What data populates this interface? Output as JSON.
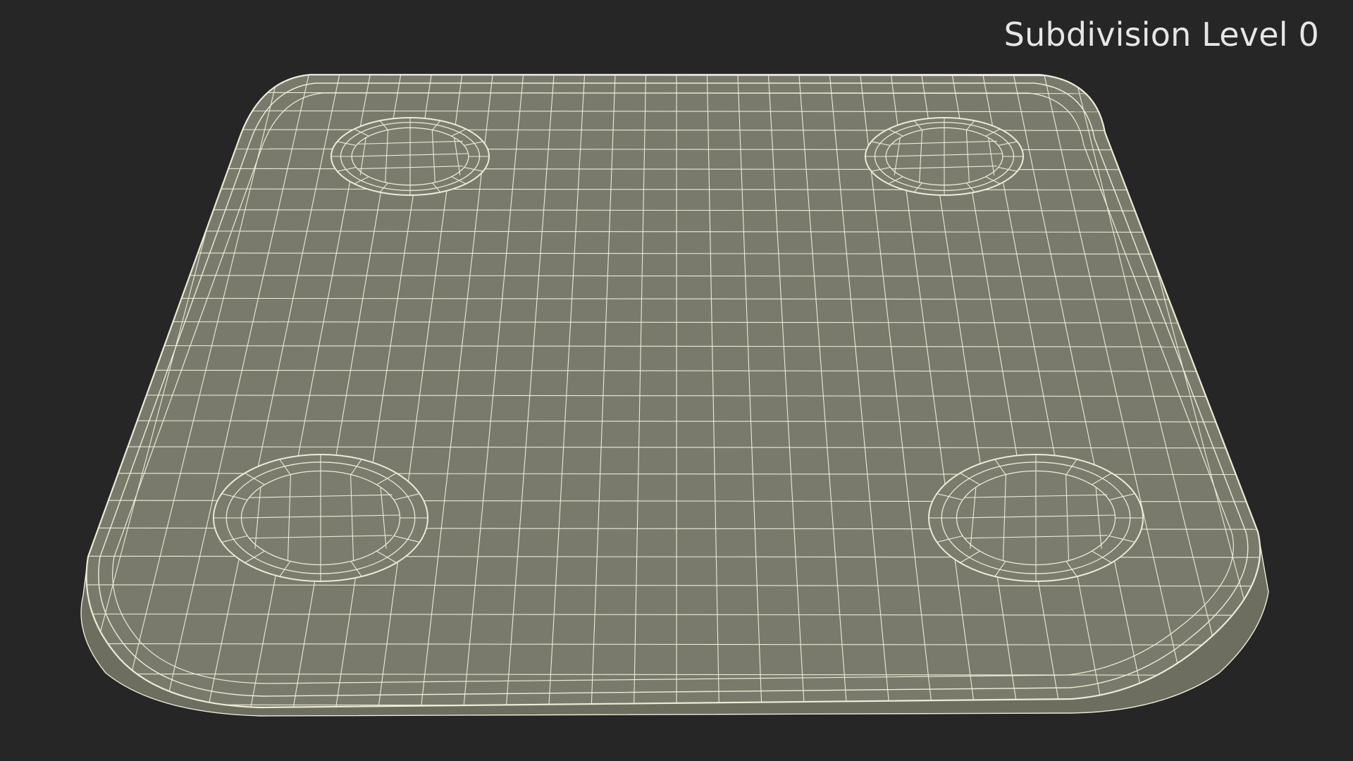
{
  "overlay": {
    "label": "Subdivision Level 0"
  },
  "colors": {
    "background": "#262626",
    "surface": "#7a7a6c",
    "surface_side": "#6d6d60",
    "wire": "#ecebd6",
    "label": "#e6e6e6"
  }
}
